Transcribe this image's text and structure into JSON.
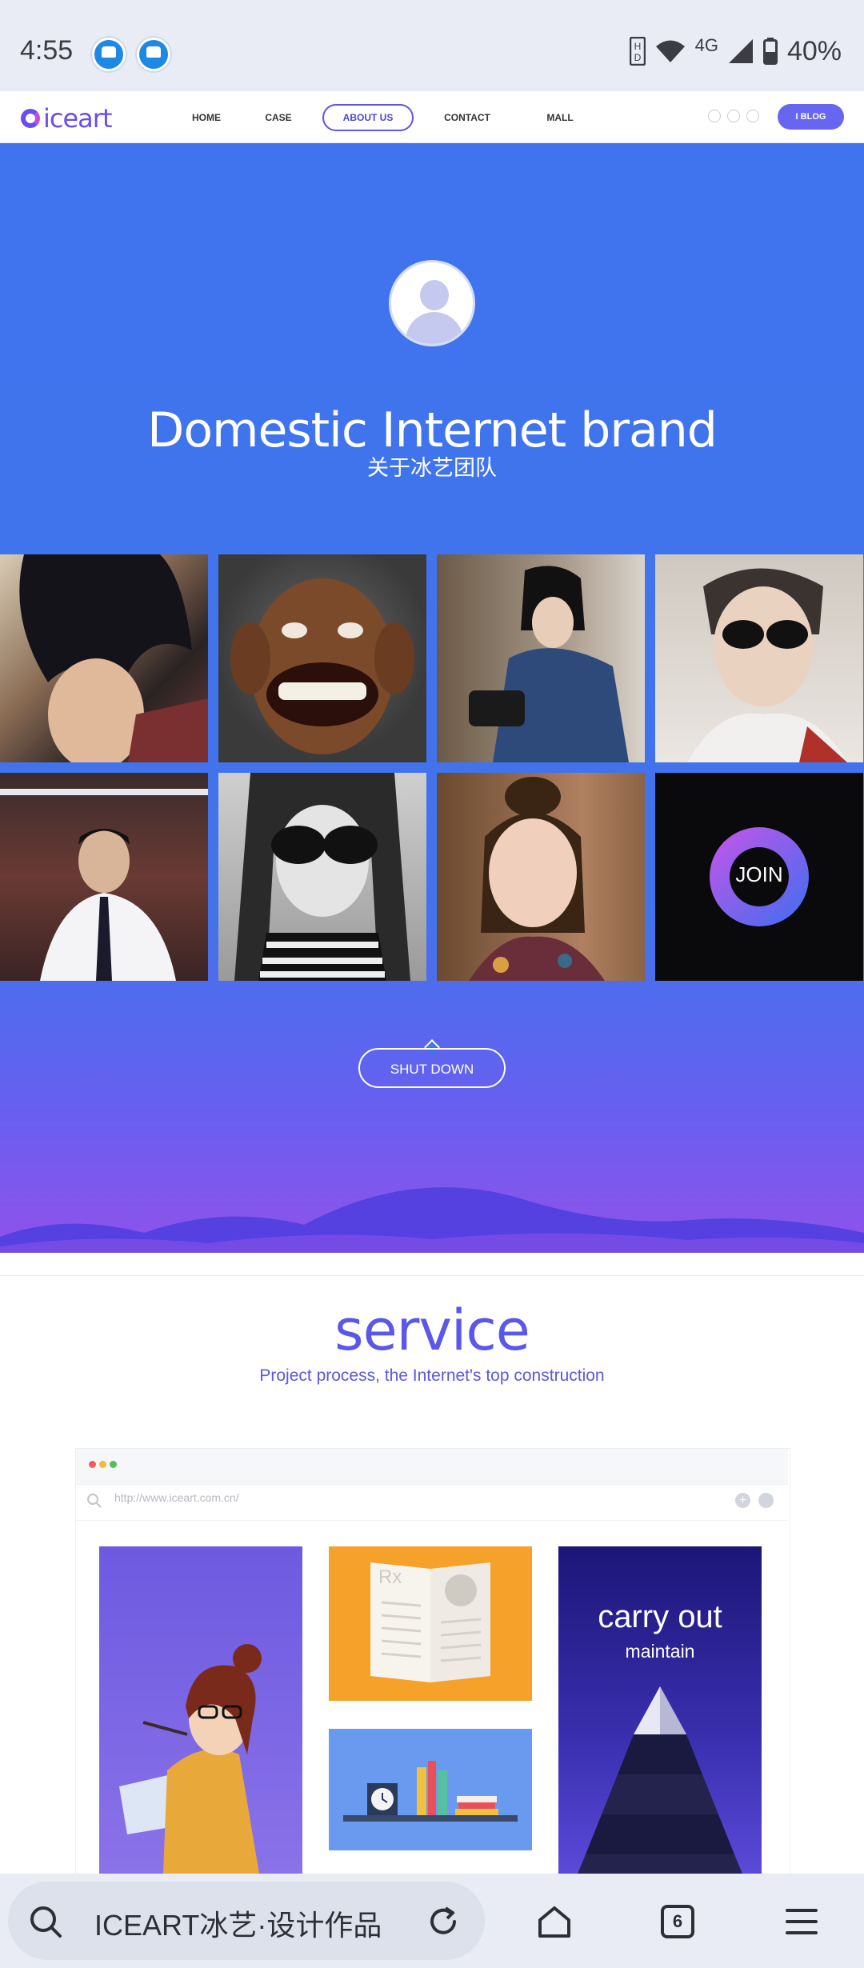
{
  "status_bar": {
    "time": "4:55",
    "network": "4G",
    "battery": "40%",
    "icons": [
      "notification-app-icon",
      "notification-app-icon",
      "hd-icon",
      "wifi-icon",
      "signal-icon",
      "battery-icon"
    ]
  },
  "header": {
    "logo": "iceart",
    "nav": [
      "HOME",
      "CASE",
      "ABOUT US",
      "CONTACT",
      "MALL"
    ],
    "active_nav": "ABOUT US",
    "social_icons": [
      "weibo-icon",
      "wechat-icon",
      "qq-icon"
    ],
    "blog_button": "I BLOG"
  },
  "hero": {
    "title": "Domestic Internet brand",
    "subtitle": "关于冰艺团队",
    "gallery": [
      {
        "name": "portrait-emo-boy"
      },
      {
        "name": "caricature-man"
      },
      {
        "name": "girl-with-camera"
      },
      {
        "name": "man-with-sunglasses"
      },
      {
        "name": "man-in-library"
      },
      {
        "name": "woman-with-sunglasses"
      },
      {
        "name": "smiling-girl"
      },
      {
        "name": "join-tile",
        "label": "JOIN"
      }
    ],
    "shut_down_button": "SHUT DOWN"
  },
  "service": {
    "title": "service",
    "subtitle": "Project process, the Internet's top construction",
    "browser_url": "http://www.iceart.com.cn/",
    "card_carry_title": "carry out",
    "card_carry_sub": "maintain",
    "card_book_label": "Rx"
  },
  "browser_chrome": {
    "omnibox_text": "ICEART冰艺·设计作品",
    "tab_count": "6"
  },
  "colors": {
    "hero_blue": "#4273ec",
    "hero_purple": "#9052ea",
    "accent": "#5a58e6",
    "blog_button": "#6766f0"
  }
}
